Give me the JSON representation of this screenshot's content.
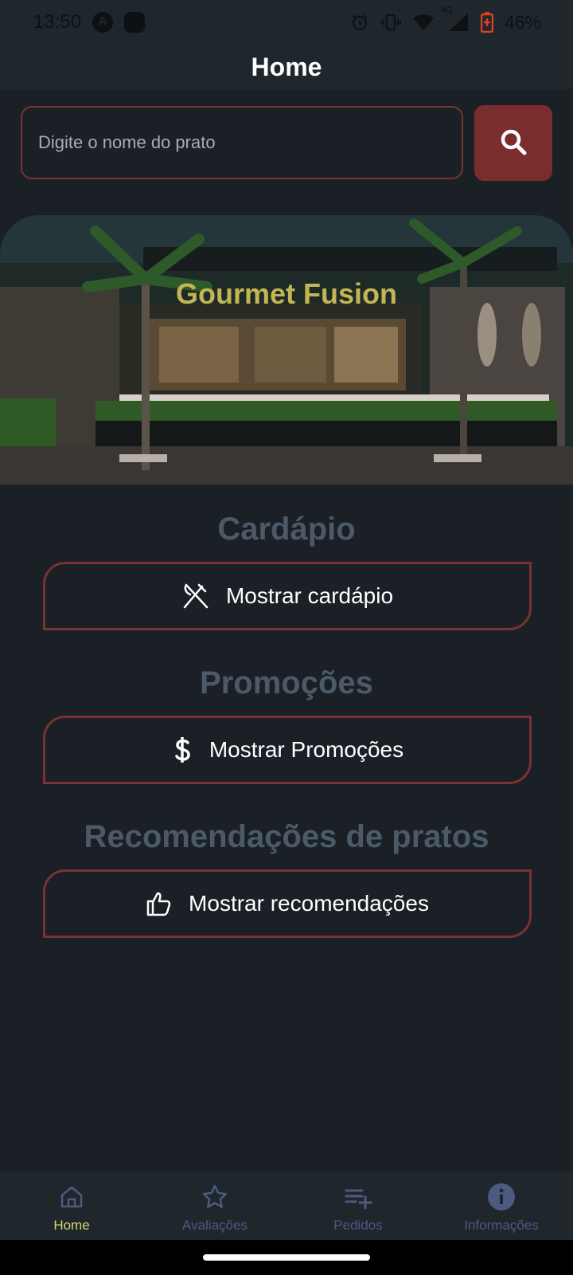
{
  "status_bar": {
    "time": "13:50",
    "app_a_icon": "android-studio-icon",
    "signal_label": "4G",
    "battery": "46%"
  },
  "header": {
    "title": "Home"
  },
  "search": {
    "placeholder": "Digite o nome do prato",
    "button_icon": "search-icon"
  },
  "hero": {
    "restaurant_name": "Gourmet Fusion"
  },
  "sections": {
    "menu": {
      "title": "Cardápio",
      "button_label": "Mostrar cardápio",
      "icon": "fork-knife-icon"
    },
    "promotions": {
      "title": "Promoções",
      "button_label": "Mostrar Promoções",
      "icon": "dollar-icon"
    },
    "recommendations": {
      "title": "Recomendações de pratos",
      "button_label": "Mostrar recomendações",
      "icon": "thumbs-up-icon"
    }
  },
  "bottom_nav": {
    "items": [
      {
        "label": "Home",
        "icon": "home-icon",
        "active": true
      },
      {
        "label": "Avaliações",
        "icon": "star-icon",
        "active": false
      },
      {
        "label": "Pedidos",
        "icon": "list-add-icon",
        "active": false
      },
      {
        "label": "Informações",
        "icon": "info-icon",
        "active": false
      }
    ]
  },
  "colors": {
    "background": "#1a2026",
    "accent": "#7a2d2d",
    "section_title": "#4c5a68",
    "hero_title": "#c4b553",
    "nav_active": "#d8d56a",
    "nav_inactive": "#4c5a80"
  }
}
